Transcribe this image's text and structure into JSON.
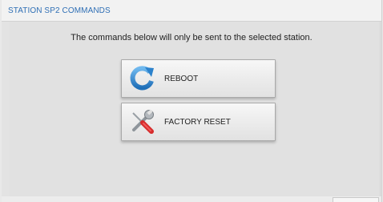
{
  "panel": {
    "title": "STATION SP2 COMMANDS",
    "info_text": "The commands below will only be sent to the selected station."
  },
  "buttons": [
    {
      "label": "REBOOT",
      "icon": "refresh-icon"
    },
    {
      "label": "FACTORY RESET",
      "icon": "tools-icon"
    }
  ],
  "colors": {
    "title": "#2f6fb5",
    "reboot_icon": "#3b8fd6",
    "panel_bg": "#e1e1e1"
  }
}
